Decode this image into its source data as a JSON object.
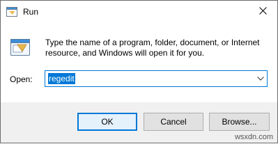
{
  "window": {
    "title": "Run",
    "title_icon": "run-app-icon",
    "close_icon": "close-icon"
  },
  "dialog": {
    "icon": "run-app-icon",
    "description_line1": "Type the name of a program, folder, document, or Internet",
    "description_line2": "resource, and Windows will open it for you.",
    "open_label": "Open:",
    "open_value": "regedit",
    "dropdown_icon": "chevron-down-icon"
  },
  "buttons": {
    "ok": "OK",
    "cancel": "Cancel",
    "browse": "Browse..."
  },
  "watermark": "wsxdn.com",
  "colors": {
    "accent": "#0078d7",
    "footer_bg": "#f0f0f0",
    "button_bg": "#e1e1e1"
  }
}
